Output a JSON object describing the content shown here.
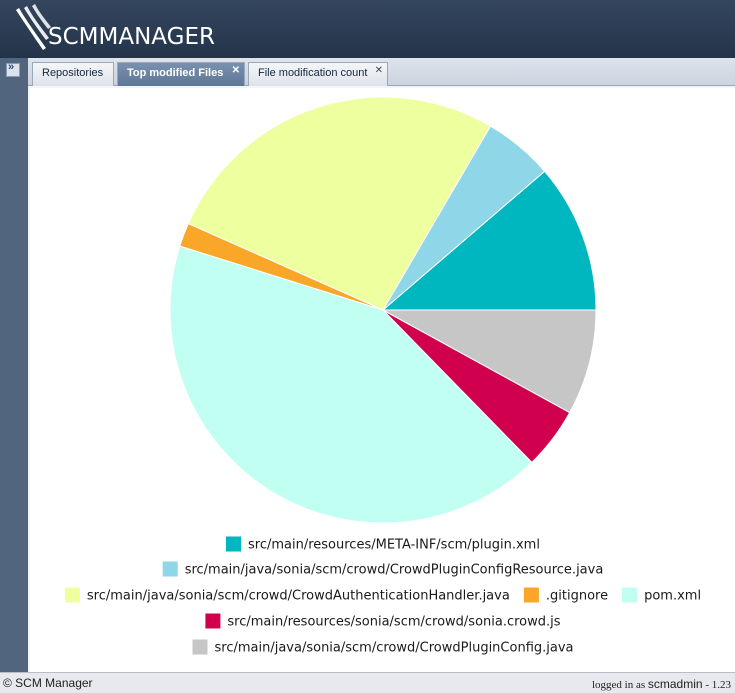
{
  "app": {
    "brand": "SCMMANAGER"
  },
  "tabs": [
    {
      "label": "Repositories",
      "active": false,
      "closable": false
    },
    {
      "label": "Top modified Files",
      "active": true,
      "closable": true
    },
    {
      "label": "File modification count",
      "active": false,
      "closable": true
    }
  ],
  "chart_data": {
    "type": "pie",
    "title": "",
    "slices": [
      {
        "label": "src/main/resources/META-INF/scm/plugin.xml",
        "value": 11.3,
        "color": "#00b6bf"
      },
      {
        "label": "src/main/java/sonia/scm/crowd/CrowdPluginConfigResource.java",
        "value": 5.3,
        "color": "#8fd6e8"
      },
      {
        "label": "src/main/java/sonia/scm/crowd/CrowdAuthenticationHandler.java",
        "value": 26.8,
        "color": "#eeffa0"
      },
      {
        "label": ".gitignore",
        "value": 1.8,
        "color": "#f9a629"
      },
      {
        "label": "pom.xml",
        "value": 42.2,
        "color": "#c0fff2"
      },
      {
        "label": "src/main/resources/sonia/scm/crowd/sonia.crowd.js",
        "value": 4.7,
        "color": "#d0004f"
      },
      {
        "label": "src/main/java/sonia/scm/crowd/CrowdPluginConfig.java",
        "value": 8.0,
        "color": "#c6c6c6"
      }
    ],
    "legend_placement": "bottom"
  },
  "footer": {
    "copyright": "© SCM Manager",
    "logged_in_prefix": "logged in as",
    "username": "scmadmin",
    "version": "- 1.23"
  }
}
